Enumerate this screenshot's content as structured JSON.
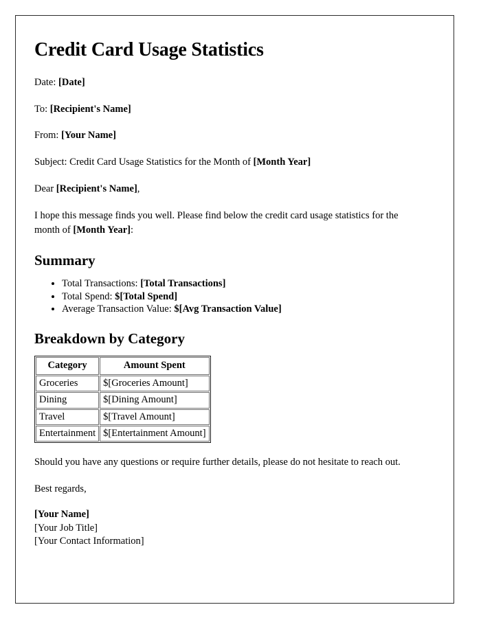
{
  "document": {
    "title": "Credit Card Usage Statistics",
    "meta": {
      "date_label": "Date: ",
      "date_value": "[Date]",
      "to_label": "To: ",
      "to_value": "[Recipient's Name]",
      "from_label": "From: ",
      "from_value": "[Your Name]",
      "subject_label": "Subject: Credit Card Usage Statistics for the Month of ",
      "subject_value": "[Month Year]"
    },
    "salutation": {
      "prefix": "Dear ",
      "name": "[Recipient's Name]",
      "suffix": ","
    },
    "intro": {
      "part1": "I hope this message finds you well. Please find below the credit card usage statistics for the month of ",
      "highlight": "[Month Year]",
      "part2": ":"
    },
    "summary": {
      "heading": "Summary",
      "items": [
        {
          "label": "Total Transactions: ",
          "value": "[Total Transactions]"
        },
        {
          "label": "Total Spend: ",
          "value": "$[Total Spend]"
        },
        {
          "label": "Average Transaction Value: ",
          "value": "$[Avg Transaction Value]"
        }
      ]
    },
    "breakdown": {
      "heading": "Breakdown by Category",
      "columns": [
        "Category",
        "Amount Spent"
      ],
      "rows": [
        {
          "category": "Groceries",
          "amount": "$[Groceries Amount]"
        },
        {
          "category": "Dining",
          "amount": "$[Dining Amount]"
        },
        {
          "category": "Travel",
          "amount": "$[Travel Amount]"
        },
        {
          "category": "Entertainment",
          "amount": "$[Entertainment Amount]"
        }
      ]
    },
    "closing": {
      "paragraph": "Should you have any questions or require further details, please do not hesitate to reach out.",
      "regards": "Best regards,"
    },
    "signature": {
      "name": "[Your Name]",
      "job_title": "[Your Job Title]",
      "contact": "[Your Contact Information]"
    }
  }
}
